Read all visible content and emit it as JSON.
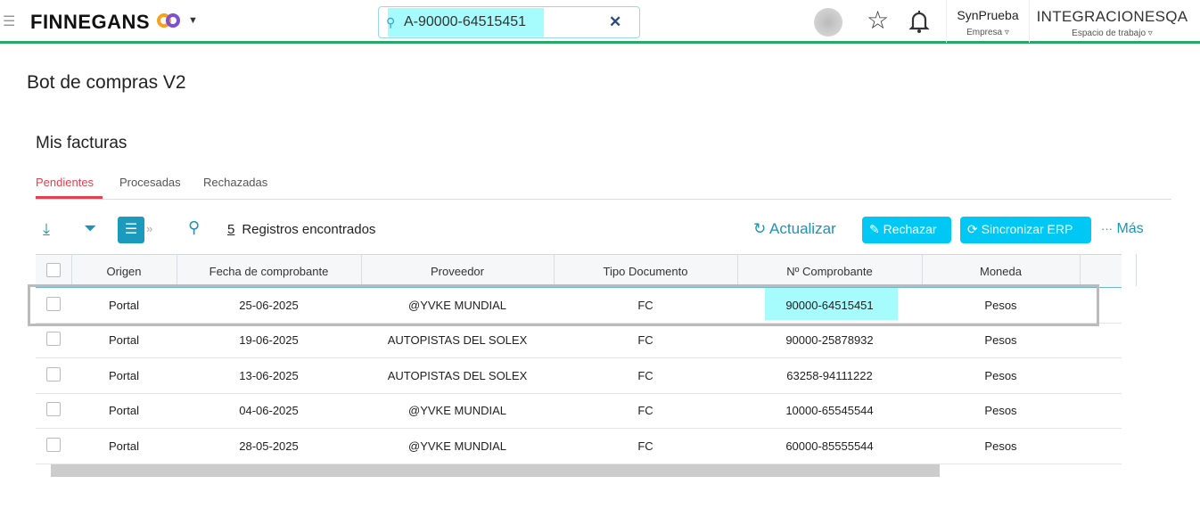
{
  "header": {
    "brand": "FINNEGANS",
    "search_value": "A-90000-64515451",
    "company": "SynPrueba",
    "company_label": "Empresa",
    "workspace": "INTEGRACIONESQA",
    "workspace_label": "Espacio de trabajo"
  },
  "page": {
    "title": "Bot de compras V2",
    "section": "Mis facturas"
  },
  "tabs": [
    {
      "label": "Pendientes"
    },
    {
      "label": "Procesadas"
    },
    {
      "label": "Rechazadas"
    }
  ],
  "toolbar": {
    "count": "5",
    "count_label": "Registros encontrados",
    "refresh": "Actualizar",
    "reject": "Rechazar",
    "sync": "Sincronizar ERP",
    "more": "Más"
  },
  "table": {
    "columns": [
      "Origen",
      "Fecha de comprobante",
      "Proveedor",
      "Tipo Documento",
      "Nº Comprobante",
      "Moneda"
    ],
    "rows": [
      [
        "Portal",
        "25-06-2025",
        "@YVKE MUNDIAL",
        "FC",
        "90000-64515451",
        "Pesos"
      ],
      [
        "Portal",
        "19-06-2025",
        "AUTOPISTAS DEL SOLEX",
        "FC",
        "90000-25878932",
        "Pesos"
      ],
      [
        "Portal",
        "13-06-2025",
        "AUTOPISTAS DEL SOLEX",
        "FC",
        "63258-94111222",
        "Pesos"
      ],
      [
        "Portal",
        "04-06-2025",
        "@YVKE MUNDIAL",
        "FC",
        "10000-65545544",
        "Pesos"
      ],
      [
        "Portal",
        "28-05-2025",
        "@YVKE MUNDIAL",
        "FC",
        "60000-85555544",
        "Pesos"
      ]
    ]
  }
}
